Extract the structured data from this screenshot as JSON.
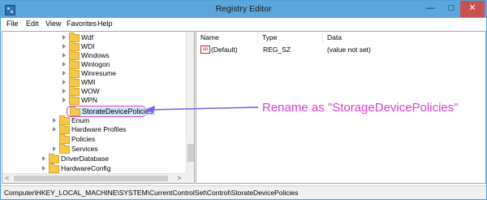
{
  "window": {
    "title": "Registry Editor"
  },
  "window_buttons": {
    "minimize": "—",
    "maximize": "□",
    "close": "✕"
  },
  "menu": [
    "File",
    "Edit",
    "View",
    "Favorites",
    "Help"
  ],
  "tree": {
    "items": [
      {
        "label": "Wdf"
      },
      {
        "label": "WDI"
      },
      {
        "label": "Windows"
      },
      {
        "label": "Winlogon"
      },
      {
        "label": "Winresume"
      },
      {
        "label": "WMI"
      },
      {
        "label": "WOW"
      },
      {
        "label": "WPN"
      },
      {
        "label": "StorateDevicePolicies",
        "selected": true
      },
      {
        "label": "Enum"
      },
      {
        "label": "Hardware Profiles"
      },
      {
        "label": "Policies"
      },
      {
        "label": "Services"
      },
      {
        "label": "DriverDatabase"
      },
      {
        "label": "HardwareConfig"
      }
    ],
    "scroll_left": "<",
    "scroll_right": ">"
  },
  "list": {
    "headers": {
      "name": "Name",
      "type": "Type",
      "data": "Data"
    },
    "rows": [
      {
        "icon": "ab",
        "name": "(Default)",
        "type": "REG_SZ",
        "data": "(value not set)"
      }
    ]
  },
  "status": {
    "path": "Computer\\HKEY_LOCAL_MACHINE\\SYSTEM\\CurrentControlSet\\Control\\StorateDevicePolicies"
  },
  "annotation": {
    "text": "Rename as \"StorageDevicePolicies\"",
    "color": "#d93fd0"
  },
  "colors": {
    "title_bar": "#5ba6dc",
    "close_button": "#c75050",
    "folder": "#f3c94b",
    "selection": "#cce8ff"
  }
}
